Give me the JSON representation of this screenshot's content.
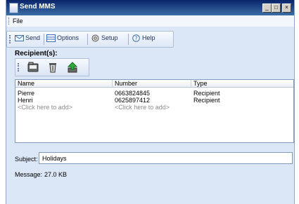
{
  "window": {
    "title": "Send MMS",
    "minimize": "_",
    "maximize": "□",
    "close": "×"
  },
  "menu": {
    "file": "File"
  },
  "toolbar": {
    "send": "Send",
    "options": "Options",
    "setup": "Setup",
    "help": "Help"
  },
  "recipients": {
    "heading": "Recipient(s):",
    "icons": [
      "phonebook-icon",
      "trash-icon",
      "import-arrow-icon"
    ],
    "columns": [
      "Name",
      "Number",
      "Type"
    ],
    "rows": [
      {
        "name": "Pierre",
        "number": "0663824845",
        "type": "Recipient"
      },
      {
        "name": "Henri",
        "number": "0625897412",
        "type": "Recipient"
      }
    ],
    "add_name": "<Click here to add>",
    "add_number": "<Click here to add>"
  },
  "subject": {
    "label": "Subject:",
    "value": "Holidays"
  },
  "message": {
    "label": "Message:",
    "value": "27.0 KB"
  },
  "colors": {
    "titlebar": "#0a246a",
    "window_bg": "#dbe6f6",
    "list_border": "#7f9db9"
  }
}
